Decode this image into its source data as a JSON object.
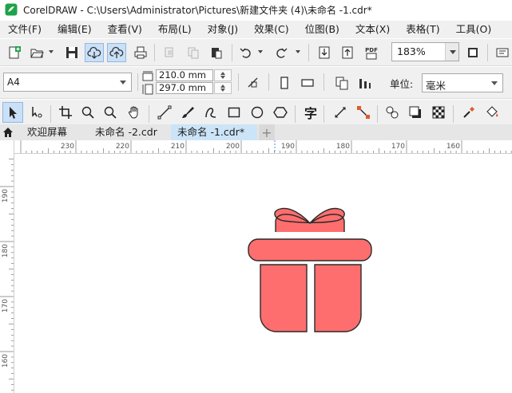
{
  "window": {
    "title": "CorelDRAW - C:\\Users\\Administrator\\Pictures\\新建文件夹 (4)\\未命名 -1.cdr*"
  },
  "menu": [
    "文件(F)",
    "编辑(E)",
    "查看(V)",
    "布局(L)",
    "对象(J)",
    "效果(C)",
    "位图(B)",
    "文本(X)",
    "表格(T)",
    "工具(O)"
  ],
  "toolbar": {
    "zoom": "183%",
    "publish_pdf_label": "PDF"
  },
  "property_bar": {
    "page_size": "A4",
    "width": "210.0 mm",
    "height": "297.0 mm",
    "units_label": "单位:",
    "units": "毫米"
  },
  "toolbox": {
    "text_tool_glyph": "字"
  },
  "tabs": [
    {
      "label": "欢迎屏幕",
      "active": false
    },
    {
      "label": "未命名 -2.cdr",
      "active": false
    },
    {
      "label": "未命名 -1.cdr*",
      "active": true
    }
  ],
  "rulers": {
    "horizontal_labels": [
      "230",
      "220",
      "210",
      "200",
      "190",
      "180",
      "170",
      "160"
    ],
    "vertical_labels": [
      "190",
      "180",
      "170",
      "160"
    ]
  },
  "colors": {
    "accent_selected": "#c9e0f7",
    "gift_fill": "#ff6e6e",
    "gift_outline": "#2a2a2a",
    "logo_green": "#1fa24a"
  }
}
